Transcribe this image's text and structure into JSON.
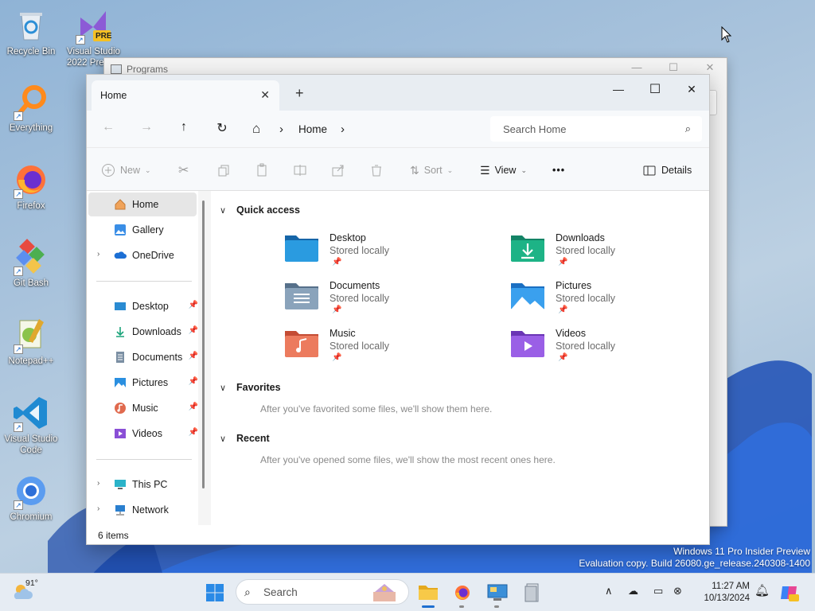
{
  "desktop": {
    "icons": [
      {
        "label": "Recycle Bin"
      },
      {
        "label": "Visual Studio 2022 Pre..."
      },
      {
        "label": "Everything"
      },
      {
        "label": "Firefox"
      },
      {
        "label": "Git Bash"
      },
      {
        "label": "Notepad++"
      },
      {
        "label": "Visual Studio Code"
      },
      {
        "label": "Chromium"
      }
    ],
    "vs_badge": "PRE",
    "watermark_line1": "Windows 11 Pro Insider Preview",
    "watermark_line2": "Evaluation copy. Build 26080.ge_release.240308-1400"
  },
  "background_window": {
    "title": "Programs"
  },
  "explorer": {
    "tab_label": "Home",
    "tab_close": "✕",
    "new_tab": "+",
    "window_controls": {
      "minimize": "—",
      "maximize": "☐",
      "close": "✕"
    },
    "address": {
      "home_glyph": "⌂",
      "crumb": "Home",
      "sep": "›"
    },
    "search_placeholder": "Search Home",
    "commands": {
      "new": "New",
      "sort": "Sort",
      "view": "View",
      "more": "•••",
      "details": "Details"
    },
    "sidebar": {
      "top": [
        {
          "label": "Home"
        },
        {
          "label": "Gallery"
        },
        {
          "label": "OneDrive"
        }
      ],
      "pinned": [
        {
          "label": "Desktop"
        },
        {
          "label": "Downloads"
        },
        {
          "label": "Documents"
        },
        {
          "label": "Pictures"
        },
        {
          "label": "Music"
        },
        {
          "label": "Videos"
        }
      ],
      "bottom": [
        {
          "label": "This PC"
        },
        {
          "label": "Network"
        }
      ]
    },
    "status": "6 items",
    "groups": {
      "quick_access": "Quick access",
      "favorites": "Favorites",
      "favorites_hint": "After you've favorited some files, we'll show them here.",
      "recent": "Recent",
      "recent_hint": "After you've opened some files, we'll show the most recent ones here."
    },
    "quick_access_items": [
      {
        "name": "Desktop",
        "sub": "Stored locally",
        "color": "#1e88c8"
      },
      {
        "name": "Downloads",
        "sub": "Stored locally",
        "color": "#1aa37a"
      },
      {
        "name": "Documents",
        "sub": "Stored locally",
        "color": "#6f8ba6"
      },
      {
        "name": "Pictures",
        "sub": "Stored locally",
        "color": "#2a8fe0"
      },
      {
        "name": "Music",
        "sub": "Stored locally",
        "color": "#e06a4e"
      },
      {
        "name": "Videos",
        "sub": "Stored locally",
        "color": "#8a4fd6"
      }
    ]
  },
  "taskbar": {
    "weather_temp": "91°",
    "search_label": "Search",
    "time": "11:27 AM",
    "date": "10/13/2024"
  }
}
